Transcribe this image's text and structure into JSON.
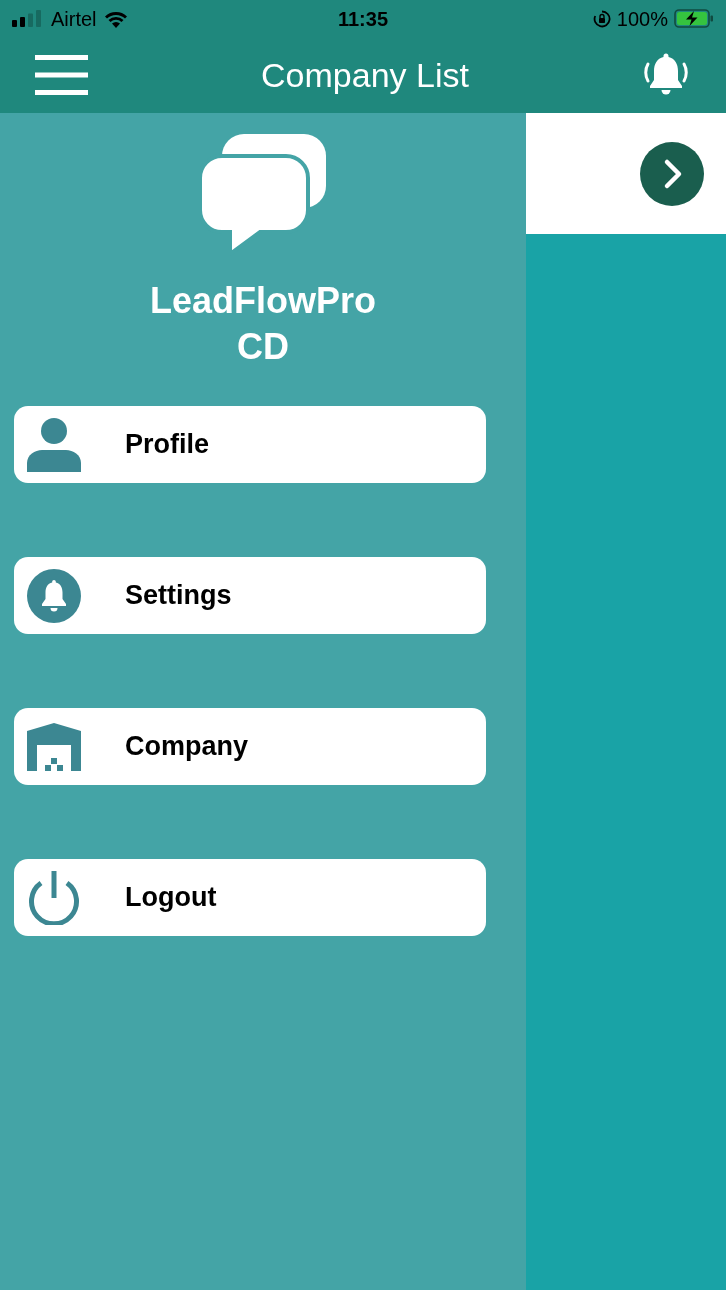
{
  "status_bar": {
    "carrier": "Airtel",
    "time": "11:35",
    "battery": "100%"
  },
  "header": {
    "title": "Company List"
  },
  "drawer": {
    "app_name": "LeadFlowPro CD",
    "menu": [
      {
        "label": "Profile",
        "kind": "profile"
      },
      {
        "label": "Settings",
        "kind": "settings"
      },
      {
        "label": "Company",
        "kind": "company"
      },
      {
        "label": "Logout",
        "kind": "logout"
      }
    ]
  }
}
